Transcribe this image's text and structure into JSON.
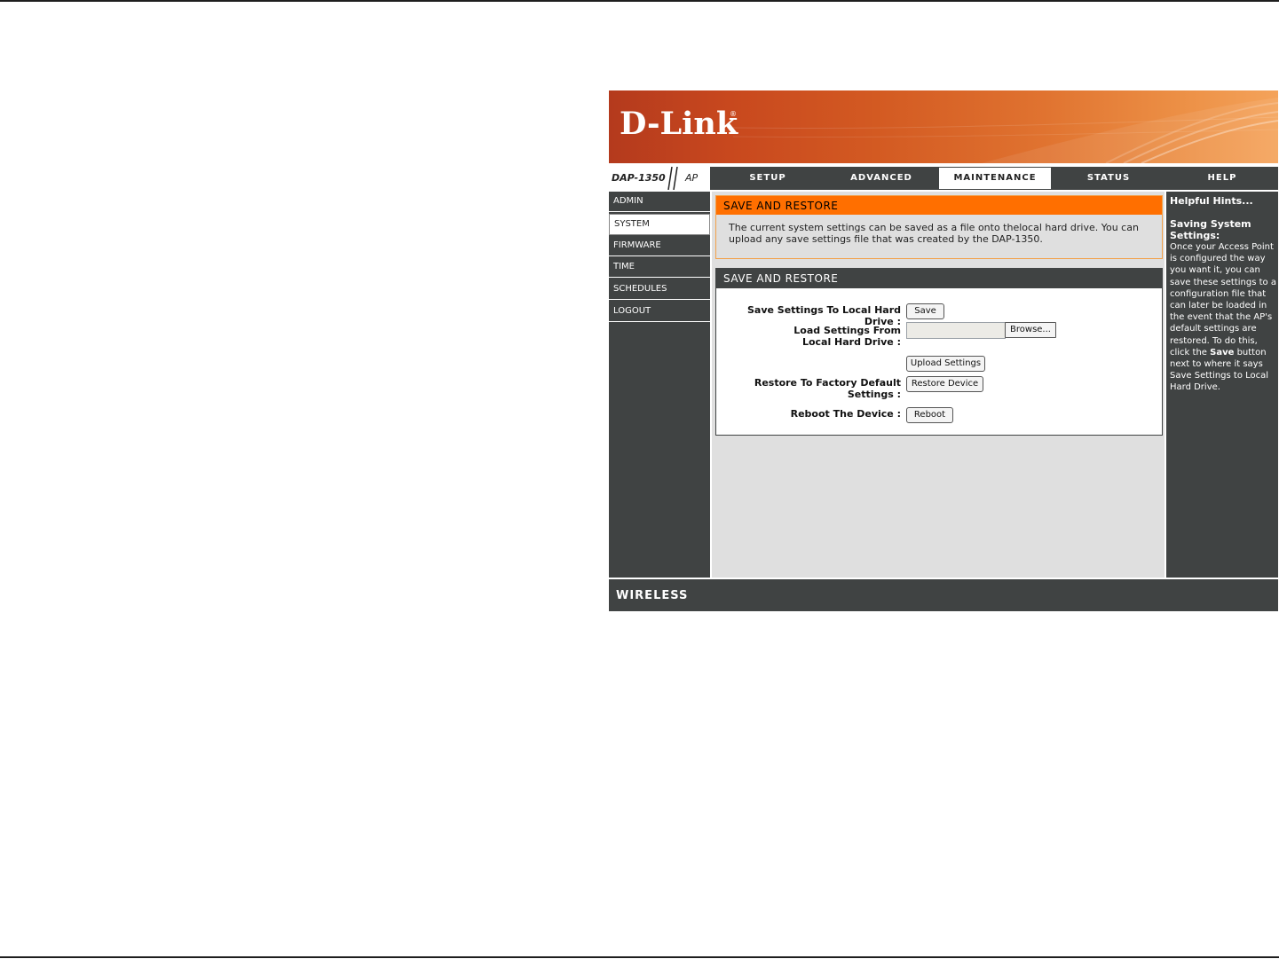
{
  "brand": {
    "logo_text": "D-Link",
    "registered_mark": "®",
    "accent": "#ff6f00",
    "dark": "#404343"
  },
  "model": {
    "name": "DAP-1350",
    "mode": "AP"
  },
  "nav": {
    "tabs": [
      {
        "label": "SETUP"
      },
      {
        "label": "ADVANCED"
      },
      {
        "label": "MAINTENANCE",
        "active": true
      },
      {
        "label": "STATUS"
      },
      {
        "label": "HELP"
      }
    ]
  },
  "sidebar": {
    "items": [
      {
        "label": "ADMIN"
      },
      {
        "label": "SYSTEM",
        "active": true
      },
      {
        "label": "FIRMWARE"
      },
      {
        "label": "TIME"
      },
      {
        "label": "SCHEDULES"
      },
      {
        "label": "LOGOUT"
      }
    ]
  },
  "intro": {
    "title": "SAVE AND RESTORE",
    "text": "The current system settings can be saved as a file onto thelocal hard drive. You can upload any save settings file that was created by the DAP-1350."
  },
  "panel": {
    "title": "SAVE AND RESTORE",
    "save_label": "Save Settings To Local Hard Drive :",
    "save_button": "Save",
    "load_label": "Load Settings From Local Hard Drive :",
    "file_value": "",
    "browse_button": "Browse...",
    "upload_button": "Upload Settings",
    "restore_label": "Restore To Factory Default Settings :",
    "restore_button": "Restore Device",
    "reboot_label": "Reboot The Device :",
    "reboot_button": "Reboot"
  },
  "help": {
    "title": "Helpful Hints...",
    "subtitle": "Saving System Settings:",
    "body_pre": "Once your Access Point is configured the way you want it, you can save these settings to a configuration file that can later be loaded in the event that the AP's default settings are restored. To do this, click the ",
    "body_bold": "Save",
    "body_post": " button next to where it says Save Settings to Local Hard Drive."
  },
  "footer": {
    "text": "WIRELESS"
  }
}
